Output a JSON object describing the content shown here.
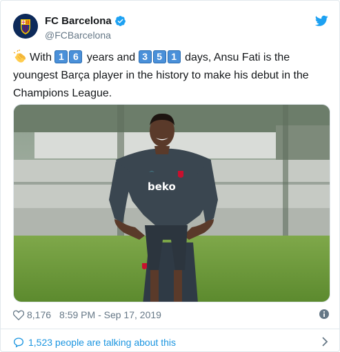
{
  "account": {
    "display_name": "FC Barcelona",
    "handle": "@FCBarcelona",
    "verified": true
  },
  "tweet": {
    "emoji": "clapping-hands",
    "text_pre": "With",
    "years_digits": [
      "1",
      "6"
    ],
    "text_mid": "years and",
    "days_digits": [
      "3",
      "5",
      "1"
    ],
    "text_post": "days, Ansu Fati is the youngest Barça player in the history to make his debut in the Champions League.",
    "image_shirt_text": "beko"
  },
  "meta": {
    "likes": "8,176",
    "timestamp": "8:59 PM - Sep 17, 2019"
  },
  "footer": {
    "talking_text": "1,523 people are talking about this"
  },
  "colors": {
    "brand_blue": "#1da1f2",
    "link_blue": "#1b95e0",
    "muted": "#657786",
    "keycap": "#4a90d9"
  }
}
